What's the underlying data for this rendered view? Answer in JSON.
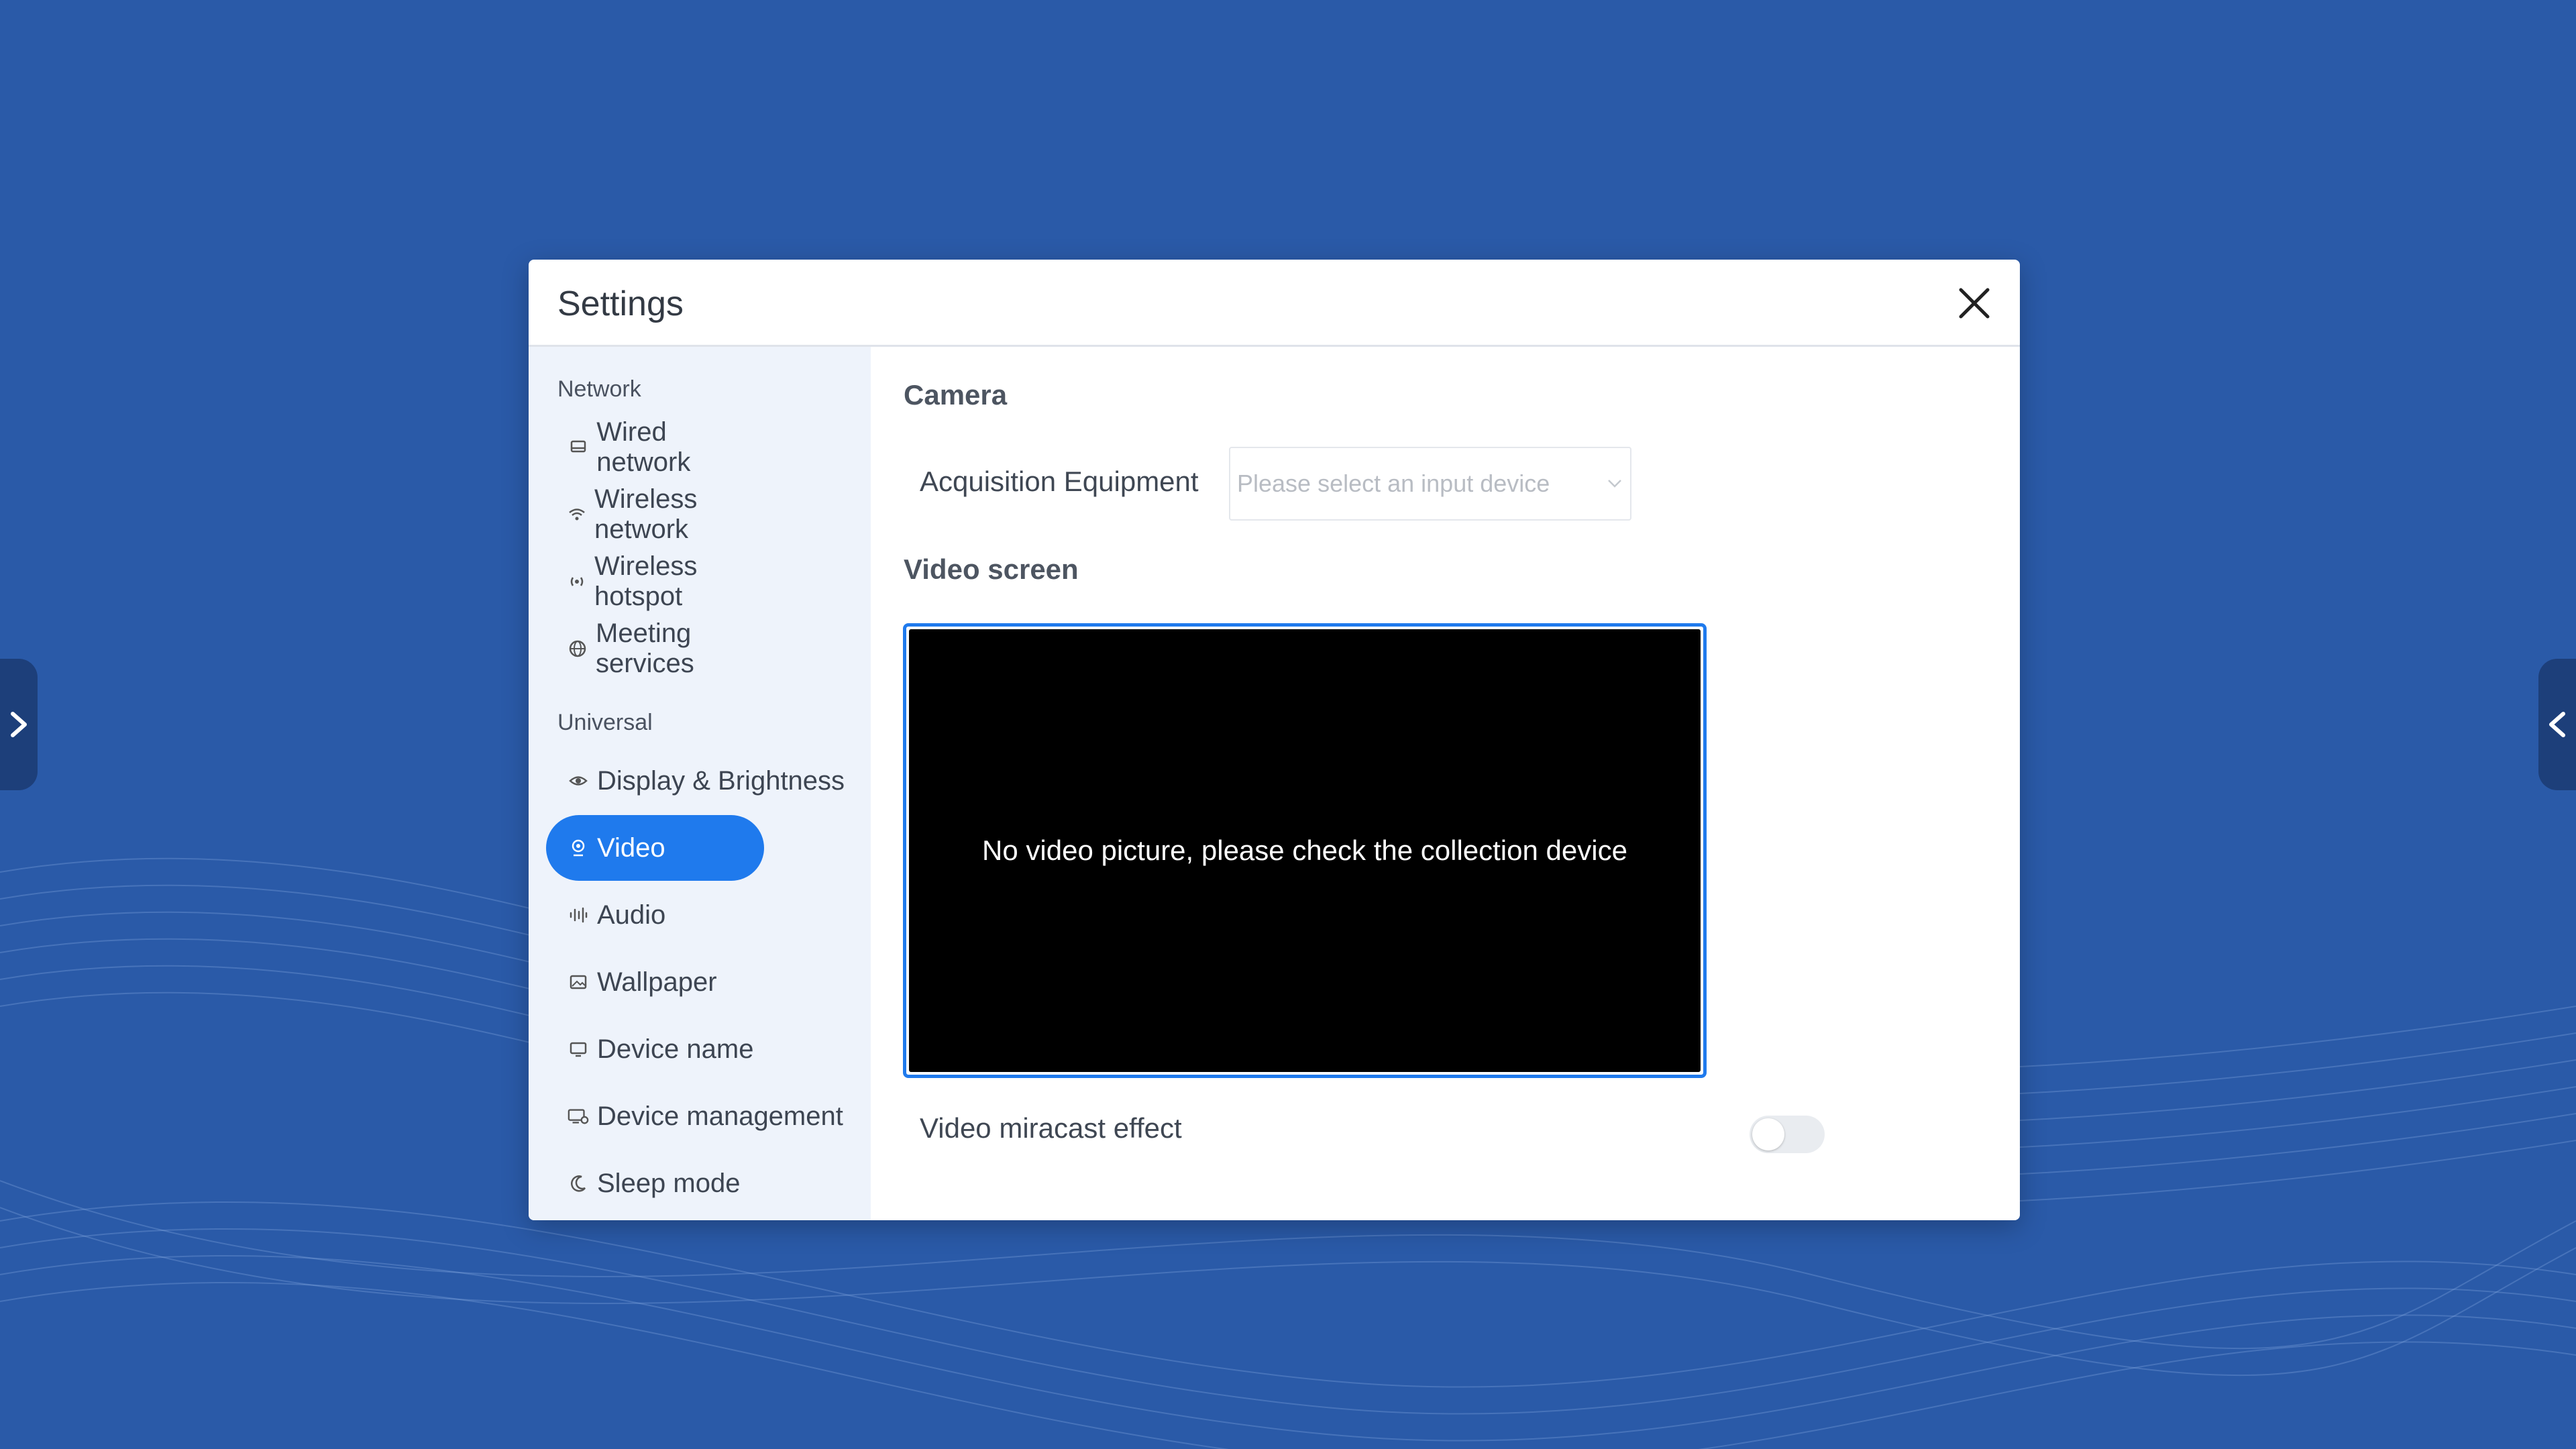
{
  "dialog": {
    "title": "Settings"
  },
  "sidebar": {
    "sections": [
      {
        "label": "Network",
        "items": [
          {
            "label": "Wired network",
            "icon": "wired-network-icon"
          },
          {
            "label": "Wireless network",
            "icon": "wifi-icon"
          },
          {
            "label": "Wireless hotspot",
            "icon": "hotspot-icon"
          },
          {
            "label": "Meeting services",
            "icon": "globe-icon"
          }
        ]
      },
      {
        "label": "Universal",
        "items": [
          {
            "label": "Display & Brightness",
            "icon": "eye-icon"
          },
          {
            "label": "Video",
            "icon": "camera-icon",
            "active": true
          },
          {
            "label": "Audio",
            "icon": "audio-wave-icon"
          },
          {
            "label": "Wallpaper",
            "icon": "image-icon"
          },
          {
            "label": "Device name",
            "icon": "monitor-icon"
          },
          {
            "label": "Device management",
            "icon": "device-settings-icon"
          },
          {
            "label": "Sleep mode",
            "icon": "moon-icon"
          }
        ]
      }
    ]
  },
  "content": {
    "camera_title": "Camera",
    "acquisition_label": "Acquisition Equipment",
    "acquisition_placeholder": "Please select an input device",
    "video_screen_title": "Video screen",
    "video_message": "No video picture, please check the collection device",
    "miracast_label": "Video miracast effect",
    "miracast_enabled": false
  },
  "colors": {
    "background": "#2a5aa8",
    "accent": "#1f7aed",
    "sidebar_bg": "#eef3fb"
  }
}
